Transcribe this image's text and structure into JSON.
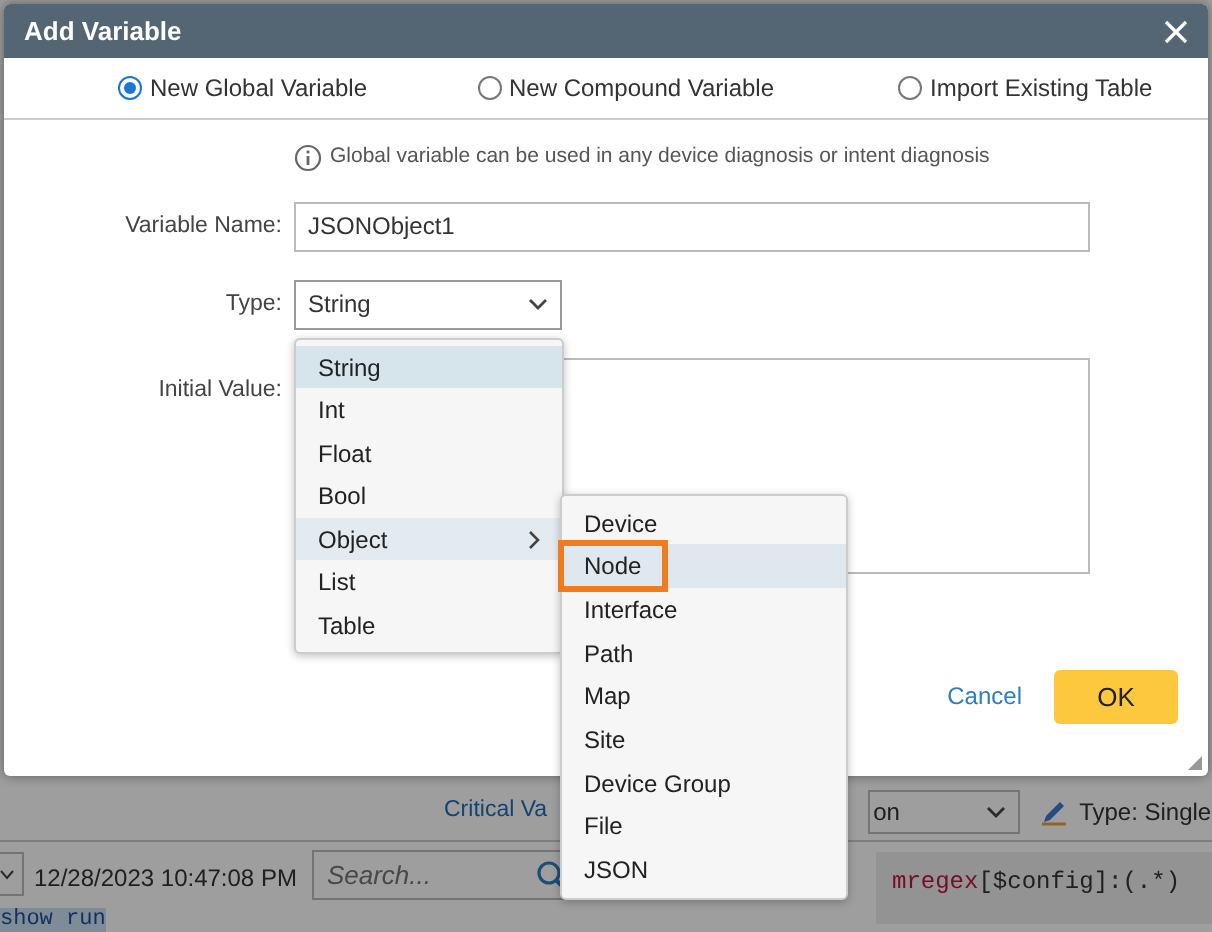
{
  "background": {
    "critical_label": "Critical Va",
    "filter_value": "on",
    "type_label": "Type: Single",
    "timestamp": "12/28/2023 10:47:08 PM",
    "search": {
      "placeholder": "Search..."
    },
    "code_text": "mregex[$config]:(.*)",
    "tree_item": "show run"
  },
  "dialog": {
    "title": "Add Variable",
    "modes": [
      {
        "label": "New Global Variable",
        "selected": true
      },
      {
        "label": "New Compound Variable",
        "selected": false
      },
      {
        "label": "Import Existing Table",
        "selected": false
      }
    ],
    "info": "Global variable can be used in any device diagnosis or intent diagnosis",
    "name_label": "Variable Name:",
    "name_value": "JSONObject1",
    "type_label": "Type:",
    "type_value": "String",
    "initial_label": "Initial Value:",
    "type_menu": [
      {
        "label": "String",
        "selected": true
      },
      {
        "label": "Int",
        "selected": false
      },
      {
        "label": "Float",
        "selected": false
      },
      {
        "label": "Bool",
        "selected": false
      },
      {
        "label": "Object",
        "selected": false,
        "expanded": true,
        "children": [
          {
            "label": "Device",
            "selected": false
          },
          {
            "label": "Node",
            "selected": true
          },
          {
            "label": "Interface",
            "selected": false
          },
          {
            "label": "Path",
            "selected": false
          },
          {
            "label": "Map",
            "selected": false
          },
          {
            "label": "Site",
            "selected": false
          },
          {
            "label": "Device Group",
            "selected": false
          },
          {
            "label": "File",
            "selected": false
          },
          {
            "label": "JSON",
            "selected": false
          }
        ]
      },
      {
        "label": "List",
        "selected": false
      },
      {
        "label": "Table",
        "selected": false
      }
    ],
    "buttons": {
      "cancel": "Cancel",
      "ok": "OK"
    }
  }
}
